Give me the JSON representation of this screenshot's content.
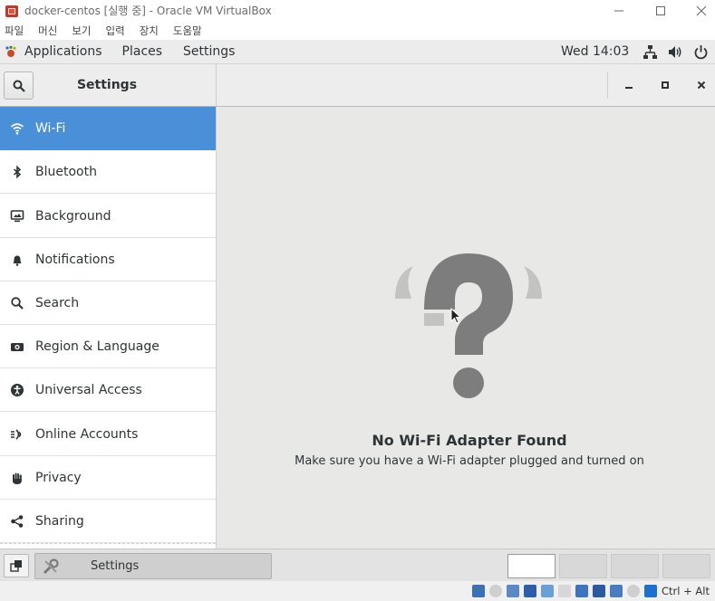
{
  "vbox": {
    "title": "docker-centos [실행 중] - Oracle VM VirtualBox",
    "menus": [
      "파일",
      "머신",
      "보기",
      "입력",
      "장치",
      "도움말"
    ],
    "host_key": "Ctrl + Alt"
  },
  "gnome": {
    "applications": "Applications",
    "places": "Places",
    "settings": "Settings",
    "clock": "Wed 14:03"
  },
  "settings": {
    "title": "Settings",
    "sidebar": [
      {
        "label": "Wi-Fi",
        "icon": "wifi-icon",
        "active": true
      },
      {
        "label": "Bluetooth",
        "icon": "bluetooth-icon"
      },
      {
        "label": "Background",
        "icon": "background-icon"
      },
      {
        "label": "Notifications",
        "icon": "bell-icon"
      },
      {
        "label": "Search",
        "icon": "search-icon"
      },
      {
        "label": "Region & Language",
        "icon": "camera-icon"
      },
      {
        "label": "Universal Access",
        "icon": "accessibility-icon"
      },
      {
        "label": "Online Accounts",
        "icon": "online-accounts-icon"
      },
      {
        "label": "Privacy",
        "icon": "hand-icon"
      },
      {
        "label": "Sharing",
        "icon": "share-icon"
      }
    ],
    "empty_state": {
      "title": "No Wi-Fi Adapter Found",
      "description": "Make sure you have a Wi-Fi adapter plugged and turned on"
    }
  },
  "taskbar": {
    "task_label": "Settings",
    "workspaces": 4,
    "active_workspace": 1
  },
  "colors": {
    "accent": "#4a90d9",
    "symbol_gray": "#7d7d7d"
  }
}
